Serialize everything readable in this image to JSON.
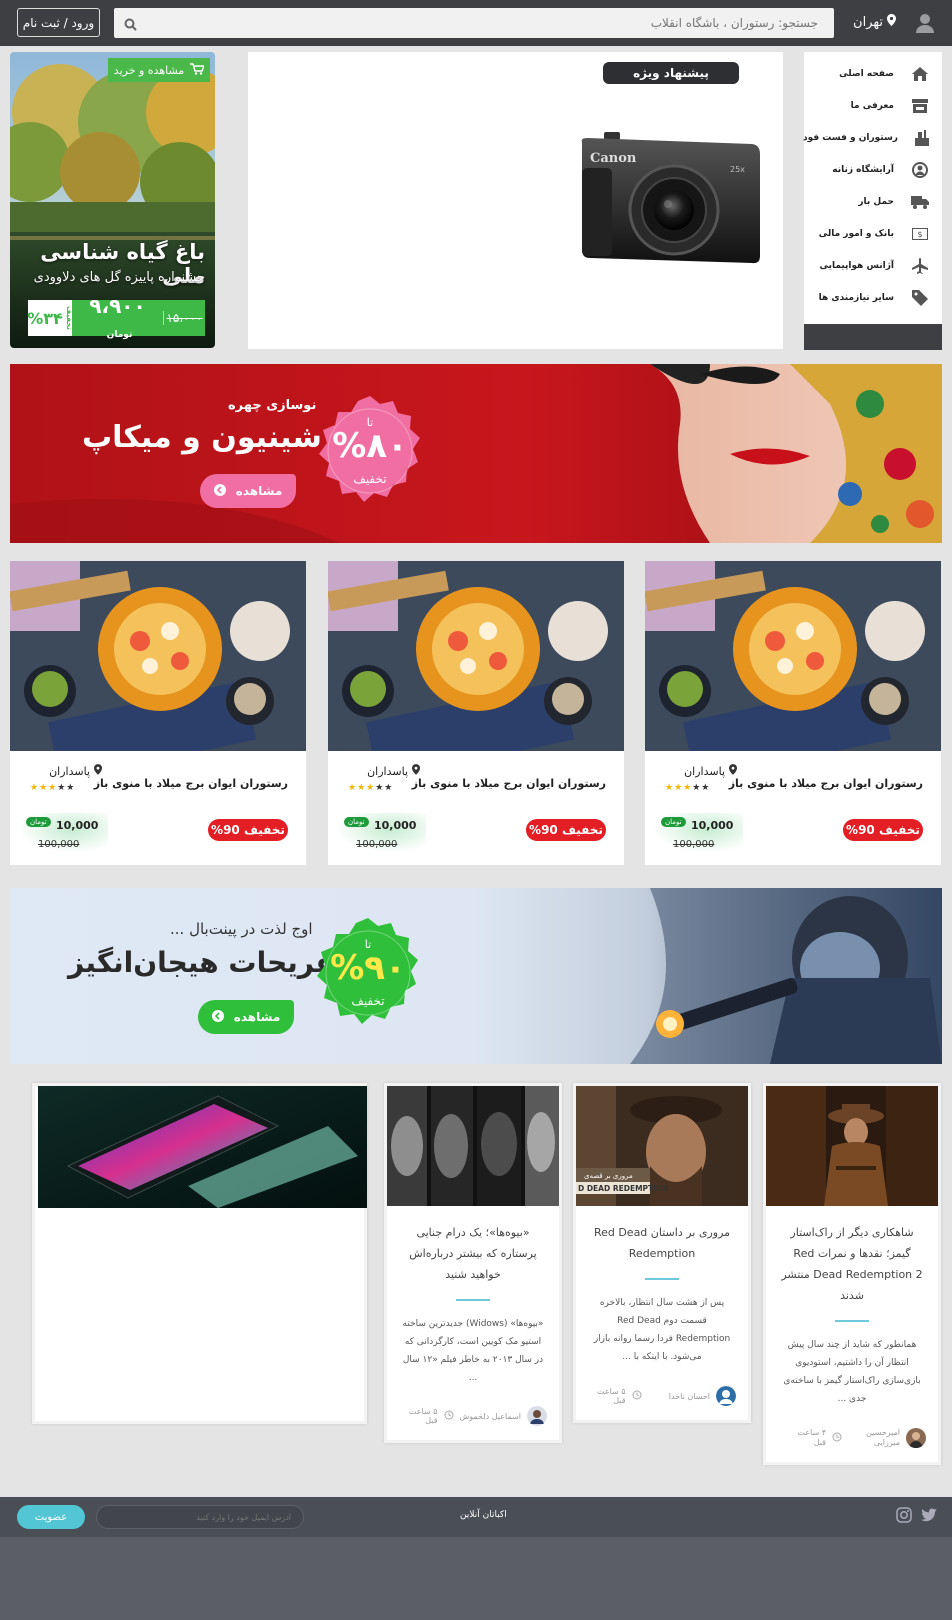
{
  "header": {
    "city": "تهران",
    "search_placeholder": "جستجو: رستوران ، باشگاه انقلاب",
    "login_label": "ورود / ثبت نام"
  },
  "sidebar": {
    "items": [
      {
        "label": "صفحه اصلی",
        "icon": "home-icon"
      },
      {
        "label": "معرفی ما",
        "icon": "store-icon"
      },
      {
        "label": "رستوران و فست فود",
        "icon": "restaurant-icon"
      },
      {
        "label": "آرایشگاه زنانه",
        "icon": "user-circle-icon"
      },
      {
        "label": "حمل بار",
        "icon": "truck-icon"
      },
      {
        "label": "بانک و امور مالی",
        "icon": "money-icon"
      },
      {
        "label": "آژانس هواپیمایی",
        "icon": "plane-icon"
      },
      {
        "label": "سایر نیازمندی ها",
        "icon": "tag-icon"
      }
    ]
  },
  "special_offer": {
    "badge": "پیشنهاد ویژه",
    "camera_brand": "Canon"
  },
  "promo": {
    "buy_label": "مشاهده و خرید",
    "title": "باغ گیاه شناسی ملی",
    "subtitle": "جشنواره پاییزه گل های دلاوودی",
    "old_price": "۱۵،۰۰۰",
    "new_price": "۹،۹۰۰",
    "unit": "تومان",
    "discount": "%۳۴",
    "discount_label": "تخفیف"
  },
  "banner_makeup": {
    "subtitle": "نوسازی چهره",
    "title": "شینیون و میکاپ",
    "seal_to": "تا",
    "seal_percent": "%۸۰",
    "seal_off": "تخفیف",
    "button": "مشاهده",
    "colors": {
      "bg": "#c4161c",
      "seal": "#f06ea1"
    }
  },
  "products": [
    {
      "name": "رستوران ایوان برج میلاد با منوی باز",
      "location": "پاسداران",
      "rating": 3,
      "discount": "تخفیف 90%",
      "toman": "تومان",
      "price": "10,000",
      "old_price": "100,000"
    },
    {
      "name": "رستوران ایوان برج میلاد با منوی باز",
      "location": "پاسداران",
      "rating": 3,
      "discount": "تخفیف 90%",
      "toman": "تومان",
      "price": "10,000",
      "old_price": "100,000"
    },
    {
      "name": "رستوران ایوان برج میلاد با منوی باز",
      "location": "پاسداران",
      "rating": 3,
      "discount": "تخفیف 90%",
      "toman": "تومان",
      "price": "10,000",
      "old_price": "100,000"
    }
  ],
  "banner_paintball": {
    "subtitle": "اوج لذت در پینت‌بال ...",
    "title": "تفریحات هیجان‌انگیز",
    "seal_to": "تا",
    "seal_percent": "%۹۰",
    "seal_off": "تخفیف",
    "button": "مشاهده",
    "colors": {
      "seal": "#2fbf3a"
    }
  },
  "articles": [
    {
      "title": "شاهکاری دیگر از راک‌استار گیمز؛ نقدها و نمرات Red Dead Redemption 2 منتشر شدند",
      "excerpt": "همانطور که شاید از چند سال پیش انتظار آن را داشتیم، استودیوی بازی‌سازی راک‌استار گیمز با ساخته‌ی جدی ...",
      "author": "امیرحسین میرزایی",
      "time": "۴ ساعت قبل"
    },
    {
      "title": "مروری بر داستان Red Dead Redemption",
      "excerpt": "پس از هشت سال انتظار، بالاخره قسمت دوم Red Dead Redemption فردا رسما روانه بازار می‌شود. با اینکه با ...",
      "author": "احسان ناخدا",
      "time": "۵ ساعت قبل",
      "image_caption": "مروری بر قصه‌ی",
      "image_logo": "D DEAD REDEMPTION"
    },
    {
      "title": "«بیوه‌ها»؛ یک درام جنایی پرستاره که بیشتر درباره‌اش خواهید شنید",
      "excerpt": "«بیوه‌ها» (Widows) جدیدترین ساخته استیو مک کویین است، کارگردانی که در سال ۲۰۱۳ به خاطر فیلم «۱۲ سال ...",
      "author": "اسماعیل دلخموش",
      "time": "۵ ساعت قبل"
    },
    {
      "title": "",
      "excerpt": "",
      "author": "",
      "time": ""
    }
  ],
  "footer": {
    "subscribe": "عضویت",
    "email_placeholder": "آدرس ایمیل خود را وارد کنید",
    "brand": "اکباتان آنلاین"
  }
}
